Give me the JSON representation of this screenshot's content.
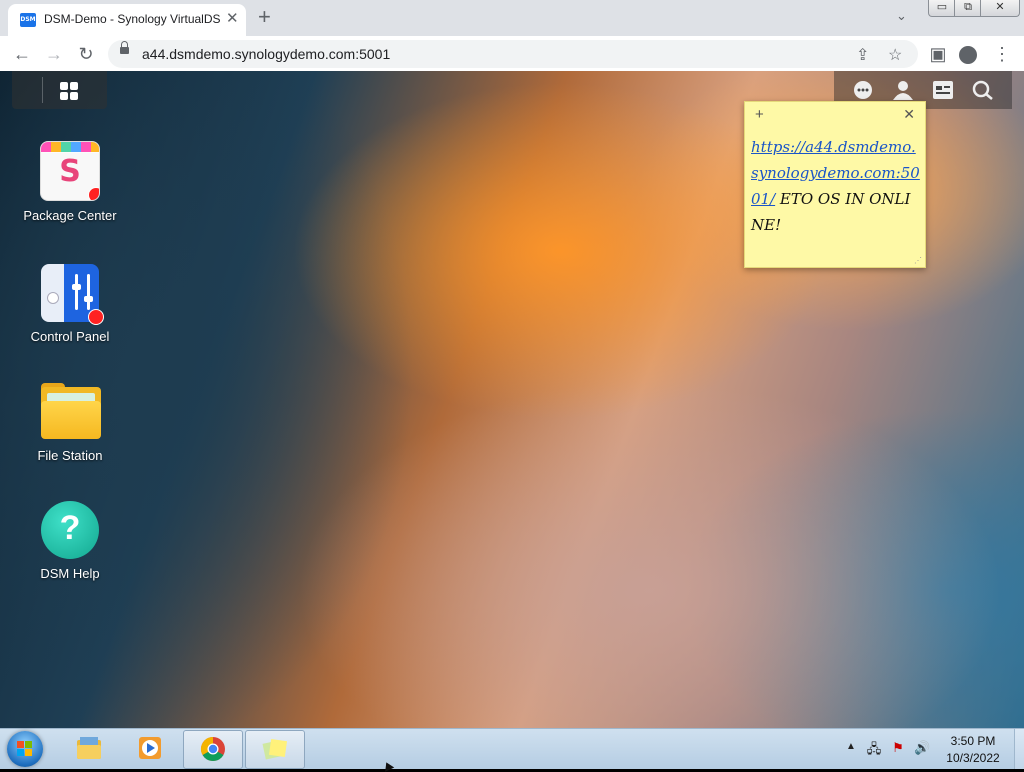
{
  "browser": {
    "tab_title": "DSM-Demo - Synology VirtualDSM",
    "favicon_text": "DSM",
    "url": "a44.dsmdemo.synologydemo.com:5001",
    "icons": [
      "back-icon",
      "forward-icon",
      "reload-icon",
      "lock-icon",
      "share-icon",
      "star-icon",
      "sidebar-icon",
      "profile-icon",
      "menu-icon"
    ]
  },
  "window_controls": {
    "minimize": "▭",
    "maximize": "⧉",
    "close": "✕"
  },
  "desktop": {
    "apps": [
      {
        "label": "Package Center",
        "icon": "package-center-icon",
        "has_badge": true
      },
      {
        "label": "Control Panel",
        "icon": "control-panel-icon",
        "has_badge": true
      },
      {
        "label": "File Station",
        "icon": "file-station-icon",
        "has_badge": false
      },
      {
        "label": "DSM Help",
        "icon": "dsm-help-icon",
        "has_badge": false
      }
    ],
    "top_right_icons": [
      "chat-icon",
      "user-icon",
      "widgets-icon",
      "search-icon"
    ]
  },
  "sticky_note": {
    "link": "https://a44.dsmdemo.synologydemo.com:5001/",
    "text": " ETO OS IN ONLINE!"
  },
  "taskbar": {
    "items": [
      "explorer-icon",
      "media-player-icon",
      "chrome-icon",
      "sticky-notes-icon"
    ],
    "time": "3:50 PM",
    "date": "10/3/2022"
  }
}
